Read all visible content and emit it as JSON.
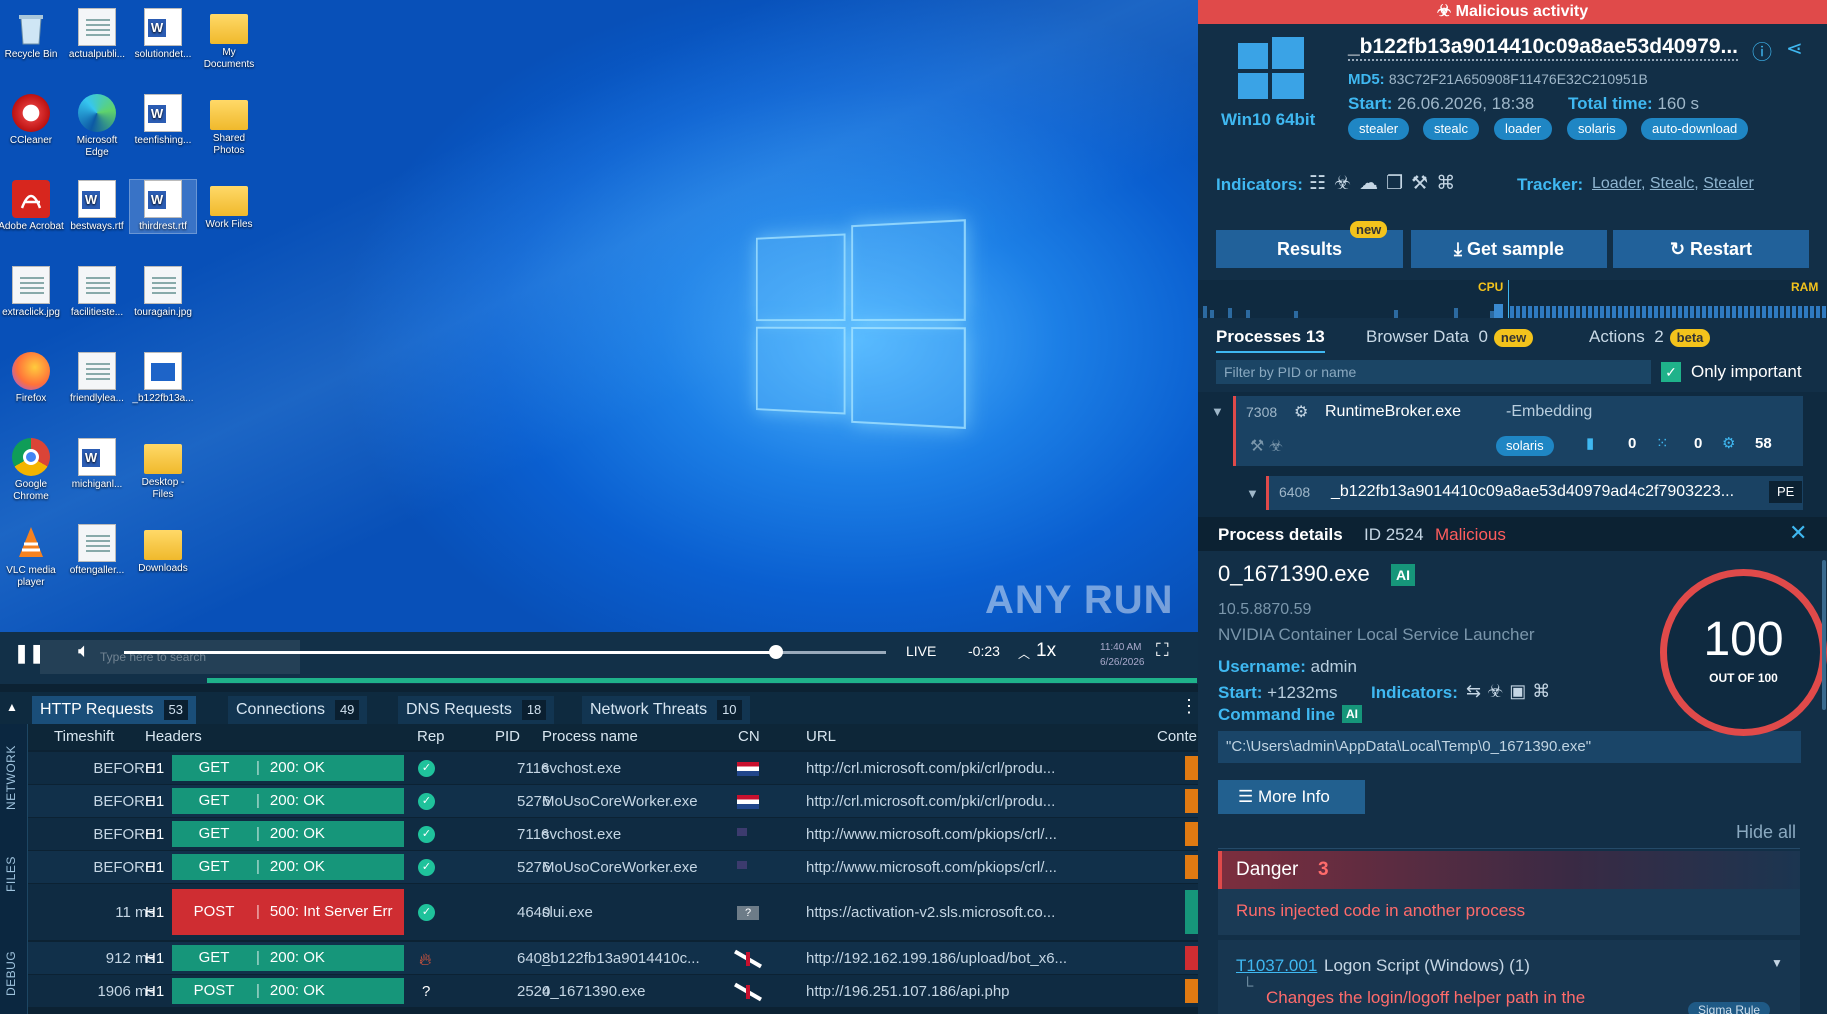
{
  "desktop": {
    "icons": [
      {
        "label": "Recycle Bin"
      },
      {
        "label": "actualpubli..."
      },
      {
        "label": "solutiondet..."
      },
      {
        "label": "My Documents"
      },
      {
        "label": "CCleaner"
      },
      {
        "label": "Microsoft Edge"
      },
      {
        "label": "teenfishing..."
      },
      {
        "label": "Shared Photos"
      },
      {
        "label": "Adobe Acrobat"
      },
      {
        "label": "bestways.rtf"
      },
      {
        "label": "thirdrest.rtf"
      },
      {
        "label": "Work Files"
      },
      {
        "label": "extraclick.jpg"
      },
      {
        "label": "facilitieste..."
      },
      {
        "label": "touragain.jpg"
      },
      {
        "label": "Firefox"
      },
      {
        "label": "friendlylea..."
      },
      {
        "label": "_b122fb13a..."
      },
      {
        "label": "Google Chrome"
      },
      {
        "label": "michiganl..."
      },
      {
        "label": "Desktop - Files"
      },
      {
        "label": "VLC media player"
      },
      {
        "label": "oftengaller..."
      },
      {
        "label": "Downloads"
      }
    ],
    "watermark": "ANY RUN",
    "search_placeholder": "Type here to search"
  },
  "player": {
    "live": "LIVE",
    "remaining": "-0:23",
    "speed": "1x",
    "clock_time": "11:40 AM",
    "clock_date": "6/26/2026",
    "progress": 0.856
  },
  "network": {
    "tabs": [
      {
        "label": "HTTP Requests",
        "count": "53"
      },
      {
        "label": "Connections",
        "count": "49"
      },
      {
        "label": "DNS Requests",
        "count": "18"
      },
      {
        "label": "Network Threats",
        "count": "10"
      }
    ],
    "side_labels": [
      "NETWORK",
      "FILES",
      "DEBUG"
    ],
    "columns": [
      "Timeshift",
      "Headers",
      "Rep",
      "PID",
      "Process name",
      "CN",
      "URL",
      "Conte"
    ],
    "rows": [
      {
        "time": "BEFORE",
        "proto": "H1",
        "method": "GET",
        "status": "200: OK",
        "rep": "ok",
        "pid": "7116",
        "proc": "svchost.exe",
        "cn": "nl",
        "url": "http://crl.microsoft.com/pki/crl/produ...",
        "content_color": "#e07a12"
      },
      {
        "time": "BEFORE",
        "proto": "H1",
        "method": "GET",
        "status": "200: OK",
        "rep": "ok",
        "pid": "5276",
        "proc": "MoUsoCoreWorker.exe",
        "cn": "nl",
        "url": "http://crl.microsoft.com/pki/crl/produ...",
        "content_color": "#e07a12"
      },
      {
        "time": "BEFORE",
        "proto": "H1",
        "method": "GET",
        "status": "200: OK",
        "rep": "ok",
        "pid": "7116",
        "proc": "svchost.exe",
        "cn": "us",
        "url": "http://www.microsoft.com/pkiops/crl/...",
        "content_color": "#e07a12"
      },
      {
        "time": "BEFORE",
        "proto": "H1",
        "method": "GET",
        "status": "200: OK",
        "rep": "ok",
        "pid": "5276",
        "proc": "MoUsoCoreWorker.exe",
        "cn": "us",
        "url": "http://www.microsoft.com/pkiops/crl/...",
        "content_color": "#e07a12"
      },
      {
        "time": "11 ms",
        "proto": "H1",
        "method": "POST",
        "status": "500: Int Server Err",
        "rep": "ok",
        "pid": "4640",
        "proc": "slui.exe",
        "cn": "unknown",
        "cn_text": "?",
        "url": "https://activation-v2.sls.microsoft.co...",
        "content_color": "#16967a"
      },
      {
        "time": "912 ms",
        "proto": "H1",
        "method": "GET",
        "status": "200: OK",
        "rep": "malicious",
        "pid": "6408",
        "proc": "_b122fb13a9014410c...",
        "cn": "gb",
        "url": "http://192.162.199.186/upload/bot_x6...",
        "content_color": "#cf2d32"
      },
      {
        "time": "1906 ms",
        "proto": "H1",
        "method": "POST",
        "status": "200: OK",
        "rep": "unknown",
        "rep_text": "?",
        "pid": "2524",
        "proc": "0_1671390.exe",
        "cn": "gb",
        "url": "http://196.251.107.186/api.php",
        "content_color": "#e07a12"
      }
    ]
  },
  "panel": {
    "banner": "Malicious activity",
    "os": "Win10 64bit",
    "filename": "_b122fb13a9014410c09a8ae53d40979...",
    "md5_label": "MD5:",
    "md5": "83C72F21A650908F11476E32C210951B",
    "start_label": "Start:",
    "start": "26.06.2026, 18:38",
    "total_label": "Total time:",
    "total": "160 s",
    "tags": [
      "stealer",
      "stealc",
      "loader",
      "solaris",
      "auto-download"
    ],
    "indicators_label": "Indicators:",
    "tracker_label": "Tracker:",
    "trackers": [
      "Loader",
      "Stealc",
      "Stealer"
    ],
    "buttons": {
      "results": "Results",
      "results_badge": "new",
      "sample": "Get sample",
      "restart": "Restart"
    },
    "cpu": "CPU",
    "ram": "RAM",
    "tabs": {
      "processes": "Processes",
      "processes_count": "13",
      "browser": "Browser Data",
      "browser_count": "0",
      "browser_badge": "new",
      "actions": "Actions",
      "actions_count": "2",
      "actions_badge": "beta"
    },
    "filter_placeholder": "Filter by PID or name",
    "only_important": "Only important",
    "proc1": {
      "pid": "7308",
      "name": "RuntimeBroker.exe",
      "note": "-Embedding",
      "tag": "solaris",
      "files": "0",
      "reg": "0",
      "mods": "58"
    },
    "proc2": {
      "pid": "6408",
      "name": "_b122fb13a9014410c09a8ae53d40979ad4c2f7903223...",
      "badge": "PE"
    },
    "details": {
      "title": "Process details",
      "id": "ID 2524",
      "verdict": "Malicious",
      "exe": "0_1671390.exe",
      "ai": "AI",
      "version": "10.5.8870.59",
      "description": "NVIDIA Container Local Service Launcher",
      "username_label": "Username:",
      "username": "admin",
      "start_label": "Start:",
      "start": "+1232ms",
      "indicators_label": "Indicators:",
      "cmd_label": "Command line",
      "cmd": "\"C:\\Users\\admin\\AppData\\Local\\Temp\\0_1671390.exe\"",
      "more_info": "More Info",
      "hide_all": "Hide all",
      "score": "100",
      "score_of": "OUT OF",
      "score_max": "100",
      "danger_label": "Danger",
      "danger_count": "3",
      "danger_item": "Runs injected code in another process",
      "mitre_id": "T1037.001",
      "mitre_text": "Logon Script (Windows) (1)",
      "mitre_detail": "Changes the login/logoff helper path in the",
      "sigma": "Sigma Rule"
    }
  },
  "colors": {
    "accent": "#3fb8f1",
    "danger": "#e04a4a",
    "ok": "#16967a",
    "panel_bg": "#122f47"
  }
}
